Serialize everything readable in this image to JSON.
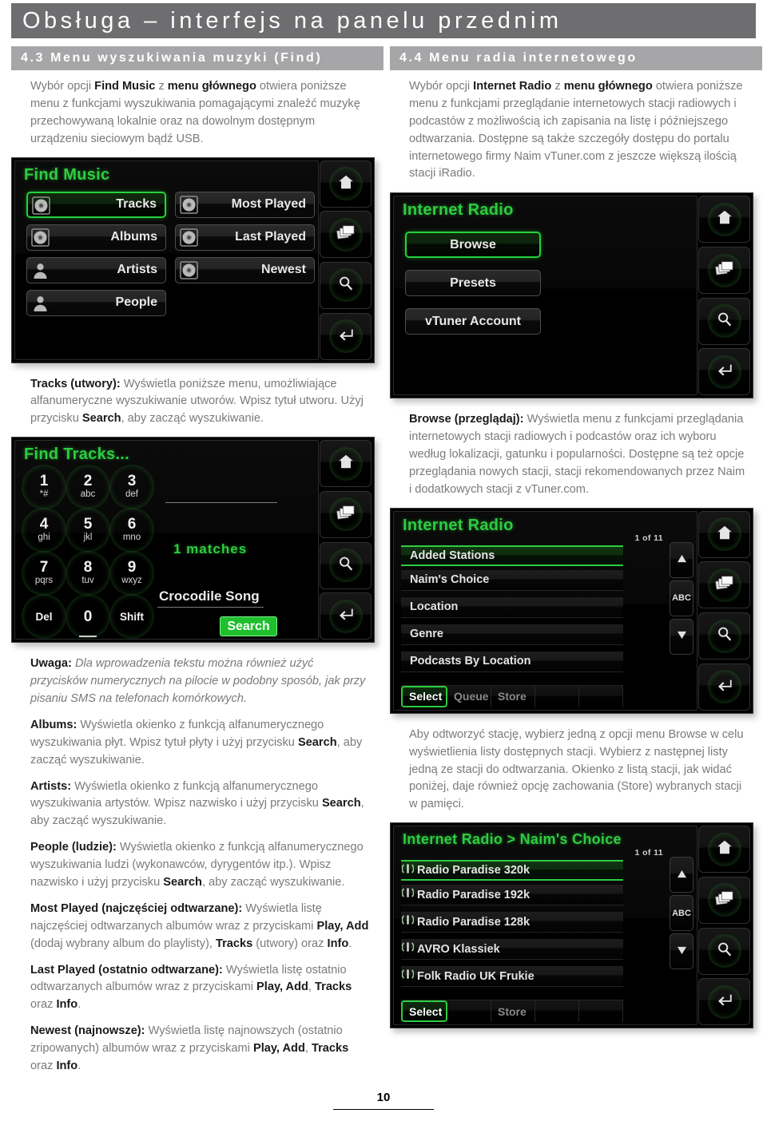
{
  "page": {
    "header_title": "Obsługa – interfejs na panelu przednim",
    "footer_page_number": "10"
  },
  "colors": {
    "header_bar": "#6e6e70",
    "section_bar": "#a6a6a8",
    "body_text": "#7a7a7c",
    "screen_accent_green": "#2ecc40",
    "screen_background": "#000000",
    "search_button_green": "#1fbf2e"
  },
  "left_column": {
    "section": {
      "number_title": "4.3 Menu wyszukiwania muzyki (Find)"
    },
    "intro_paragraph": {
      "part1": "Wybór opcji ",
      "bold1": "Find Music",
      "part2": " z ",
      "bold2": "menu głównego",
      "part3": " otwiera poniższe menu z funkcjami wyszukiwania pomagającymi znaleźć muzykę przechowywaną lokalnie oraz na dowolnym dostępnym urządzeniu sieciowym bądź USB."
    },
    "find_music_screen": {
      "title": "Find Music",
      "buttons": [
        {
          "label": "Tracks",
          "icon": "disc-icon",
          "selected": true
        },
        {
          "label": "Albums",
          "icon": "disc-icon",
          "selected": false
        },
        {
          "label": "Artists",
          "icon": "person-icon",
          "selected": false
        },
        {
          "label": "People",
          "icon": "person-icon",
          "selected": false
        },
        {
          "label": "Most Played",
          "icon": "disc-icon",
          "selected": false
        },
        {
          "label": "Last Played",
          "icon": "disc-icon",
          "selected": false
        },
        {
          "label": "Newest",
          "icon": "disc-icon",
          "selected": false
        }
      ],
      "hard_keys": [
        "home-icon",
        "layers-icon",
        "magnifier-icon",
        "enter-icon"
      ]
    },
    "tracks_paragraph": {
      "bold_lead": "Tracks (utwory):",
      "text1": " Wyświetla poniższe menu, umożliwiające alfanumeryczne wyszukiwanie utworów. Wpisz tytuł utworu. Użyj przycisku ",
      "bold_mid": "Search",
      "text2": ", aby zacząć wyszukiwanie."
    },
    "find_tracks_screen": {
      "title": "Find Tracks...",
      "keys": [
        {
          "num": "1",
          "sub": "*#"
        },
        {
          "num": "2",
          "sub": "abc"
        },
        {
          "num": "3",
          "sub": "def"
        },
        {
          "num": "4",
          "sub": "ghi"
        },
        {
          "num": "5",
          "sub": "jkl"
        },
        {
          "num": "6",
          "sub": "mno"
        },
        {
          "num": "7",
          "sub": "pqrs"
        },
        {
          "num": "8",
          "sub": "tuv"
        },
        {
          "num": "9",
          "sub": "wxyz"
        }
      ],
      "word_keys": [
        "Del",
        "0",
        "Shift"
      ],
      "matches_text": "1  matches",
      "entry_text": "Crocodile Song",
      "search_button": "Search",
      "hard_keys": [
        "home-icon",
        "layers-icon",
        "magnifier-icon",
        "enter-icon"
      ]
    },
    "note_paragraph": {
      "bold_lead": "Uwaga:",
      "italic": " Dla wprowadzenia tekstu można również użyć przycisków numerycznych na pilocie w podobny sposób, jak przy pisaniu SMS na telefonach komórkowych."
    },
    "albums_paragraph": {
      "bold_lead": "Albums:",
      "text1": " Wyświetla okienko z funkcją alfanumerycznego wyszukiwania płyt. Wpisz tytuł płyty i użyj przycisku ",
      "bold_mid": "Search",
      "text2": ", aby zacząć wyszukiwanie."
    },
    "artists_paragraph": {
      "bold_lead": "Artists:",
      "text1": " Wyświetla okienko z funkcją alfanumerycznego wyszukiwania artystów. Wpisz nazwisko i użyj przycisku ",
      "bold_mid": "Search",
      "text2": ", aby zacząć wyszukiwanie."
    },
    "people_paragraph": {
      "bold_lead": "People (ludzie):",
      "text1": " Wyświetla okienko z funkcją alfanumerycznego wyszukiwania ludzi (wykonawców, dyrygentów itp.). Wpisz nazwisko i użyj przycisku ",
      "bold_mid": "Search",
      "text2": ", aby zacząć wyszukiwanie."
    },
    "most_played_paragraph": {
      "bold_lead": "Most Played (najczęściej odtwarzane):",
      "text1": " Wyświetla listę najczęściej odtwarzanych albumów wraz z przyciskami ",
      "bold_a": "Play, Add",
      "text2": " (dodaj wybrany album do playlisty), ",
      "bold_b": "Tracks",
      "text3": " (utwory) oraz ",
      "bold_c": "Info",
      "text4": "."
    },
    "last_played_paragraph": {
      "bold_lead": "Last Played (ostatnio odtwarzane):",
      "text1": " Wyświetla listę ostatnio odtwarzanych albumów wraz z przyciskami ",
      "bold_a": "Play, Add",
      "text2": ", ",
      "bold_b": "Tracks",
      "text3": " oraz ",
      "bold_c": "Info",
      "text4": "."
    },
    "newest_paragraph": {
      "bold_lead": "Newest (najnowsze):",
      "text1": " Wyświetla listę najnowszych (ostatnio zripowanych) albumów wraz z przyciskami ",
      "bold_a": "Play, Add",
      "text2": ", ",
      "bold_b": "Tracks",
      "text3": " oraz ",
      "bold_c": "Info",
      "text4": "."
    }
  },
  "right_column": {
    "section": {
      "number_title": "4.4 Menu radia internetowego"
    },
    "intro_paragraph": {
      "part1": "Wybór opcji ",
      "bold1": "Internet Radio",
      "part2": " z ",
      "bold2": "menu głównego",
      "part3": " otwiera poniższe menu z funkcjami przeglądanie internetowych stacji radiowych i podcastów z możliwością ich zapisania na listę i późniejszego odtwarzania. Dostępne są także szczegóły dostępu do portalu internetowego firmy Naim vTuner.com z jeszcze większą ilością stacji iRadio."
    },
    "internet_radio_screen": {
      "title": "Internet Radio",
      "buttons": [
        {
          "label": "Browse",
          "selected": true
        },
        {
          "label": "Presets",
          "selected": false
        },
        {
          "label": "vTuner Account",
          "selected": false
        }
      ],
      "hard_keys": [
        "home-icon",
        "layers-icon",
        "magnifier-icon",
        "enter-icon"
      ]
    },
    "browse_paragraph": {
      "bold_lead": "Browse (przeglądaj):",
      "text1": " Wyświetla menu z funkcjami przeglądania internetowych stacji radiowych i podcastów oraz ich wyboru według lokalizacji, gatunku i popularności. Dostępne są też opcje przeglądania nowych stacji, stacji rekomendowanych przez Naim i dodatkowych stacji z vTuner.com."
    },
    "browse_list_screen": {
      "title": "Internet Radio",
      "page_count": "1 of 11",
      "rows": [
        {
          "label": "Added Stations",
          "selected": true
        },
        {
          "label": "Naim's Choice",
          "selected": false
        },
        {
          "label": "Location",
          "selected": false
        },
        {
          "label": "Genre",
          "selected": false
        },
        {
          "label": "Podcasts By Location",
          "selected": false
        }
      ],
      "scroll_buttons": [
        "up-arrow-icon",
        "ABC",
        "down-arrow-icon"
      ],
      "soft_keys": [
        {
          "label": "Select",
          "active": true
        },
        {
          "label": "Queue",
          "active": false
        },
        {
          "label": "Store",
          "active": false
        },
        {
          "label": "",
          "active": false
        },
        {
          "label": "",
          "active": false
        }
      ],
      "hard_keys": [
        "home-icon",
        "layers-icon",
        "magnifier-icon",
        "enter-icon"
      ]
    },
    "play_station_paragraph": {
      "text": "Aby odtworzyć stację, wybierz jedną z opcji menu Browse w celu wyświetlienia listy dostępnych stacji. Wybierz z następnej listy jedną ze stacji do odtwarzania. Okienko z listą stacji, jak widać poniżej, daje również opcję zachowania (Store) wybranych stacji w pamięci."
    },
    "naims_choice_screen": {
      "title": "Internet Radio > Naim's Choice",
      "page_count": "1 of 11",
      "rows": [
        {
          "label": "Radio Paradise 320k",
          "icon": "radio-wave-icon",
          "selected": true
        },
        {
          "label": "Radio Paradise 192k",
          "icon": "radio-wave-icon",
          "selected": false
        },
        {
          "label": "Radio Paradise 128k",
          "icon": "radio-wave-icon",
          "selected": false
        },
        {
          "label": "AVRO Klassiek",
          "icon": "radio-wave-icon",
          "selected": false
        },
        {
          "label": "Folk Radio UK Frukie",
          "icon": "radio-wave-icon",
          "selected": false
        }
      ],
      "scroll_buttons": [
        "up-arrow-icon",
        "ABC",
        "down-arrow-icon"
      ],
      "soft_keys": [
        {
          "label": "Select",
          "active": true
        },
        {
          "label": "",
          "active": false
        },
        {
          "label": "Store",
          "active": false
        },
        {
          "label": "",
          "active": false
        },
        {
          "label": "",
          "active": false
        }
      ],
      "hard_keys": [
        "home-icon",
        "layers-icon",
        "magnifier-icon",
        "enter-icon"
      ]
    }
  }
}
